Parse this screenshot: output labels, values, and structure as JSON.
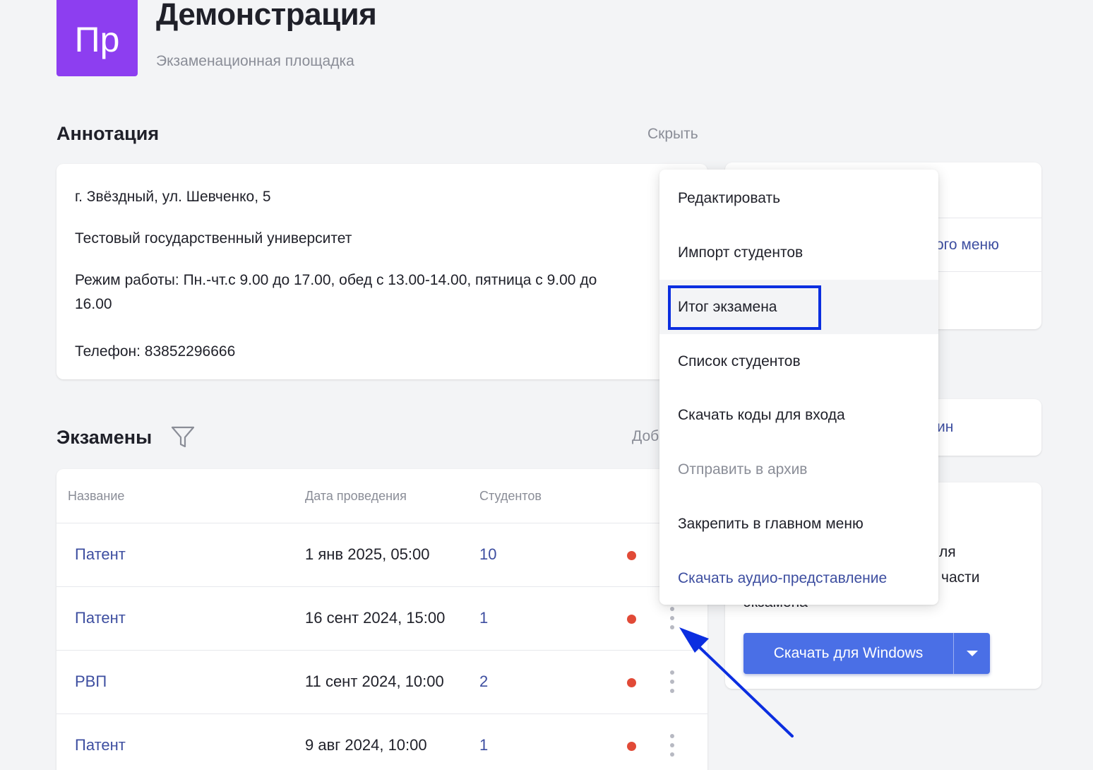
{
  "header": {
    "logo_initials": "Пр",
    "title": "Демонстрация",
    "subtitle": "Экзаменационная площадка"
  },
  "annotation": {
    "title": "Аннотация",
    "hide_label": "Скрыть",
    "lines": [
      "г. Звёздный, ул. Шевченко, 5",
      "Тестовый государственный университет",
      "Режим работы: Пн.-чт.с 9.00 до 17.00, обед с 13.00-14.00, пятница с 9.00 до",
      "16.00",
      "Телефон: 83852296666"
    ]
  },
  "exams": {
    "title": "Экзамены",
    "add_label": "Доб",
    "columns": [
      "Название",
      "Дата проведения",
      "Студентов"
    ],
    "rows": [
      {
        "name": "Патент",
        "date": "1 янв 2025, 05:00",
        "students": "10"
      },
      {
        "name": "Патент",
        "date": "16 сент 2024, 15:00",
        "students": "1"
      },
      {
        "name": "РВП",
        "date": "11 сент 2024, 10:00",
        "students": "2"
      },
      {
        "name": "Патент",
        "date": "9 авг 2024, 10:00",
        "students": "1"
      }
    ],
    "status_color": "#e14a37"
  },
  "right_panel": {
    "card1_visible_text": "ого меню",
    "card2_visible_text": "ин",
    "card3_line1": "ля",
    "card3_line2": "части",
    "card3_line3": "экзамена",
    "download_button": "Скачать для Windows"
  },
  "context_menu": {
    "items": [
      {
        "label": "Редактировать",
        "state": "normal"
      },
      {
        "label": "Импорт студентов",
        "state": "normal"
      },
      {
        "label": "Итог экзамена",
        "state": "highlighted"
      },
      {
        "label": "Список студентов",
        "state": "normal"
      },
      {
        "label": "Скачать коды для входа",
        "state": "normal"
      },
      {
        "label": "Отправить в архив",
        "state": "disabled"
      },
      {
        "label": "Закрепить в главном меню",
        "state": "normal"
      },
      {
        "label": "Скачать аудио-представление",
        "state": "accent"
      }
    ]
  },
  "icons": {
    "filter": "filter-icon",
    "kebab": "more-vertical-icon",
    "caret": "caret-down-icon"
  },
  "colors": {
    "accent": "#3d4ea0",
    "logo_bg": "#8d3ef0",
    "button_bg": "#4a6fe6",
    "annotation_stroke": "#0b2ee0"
  }
}
